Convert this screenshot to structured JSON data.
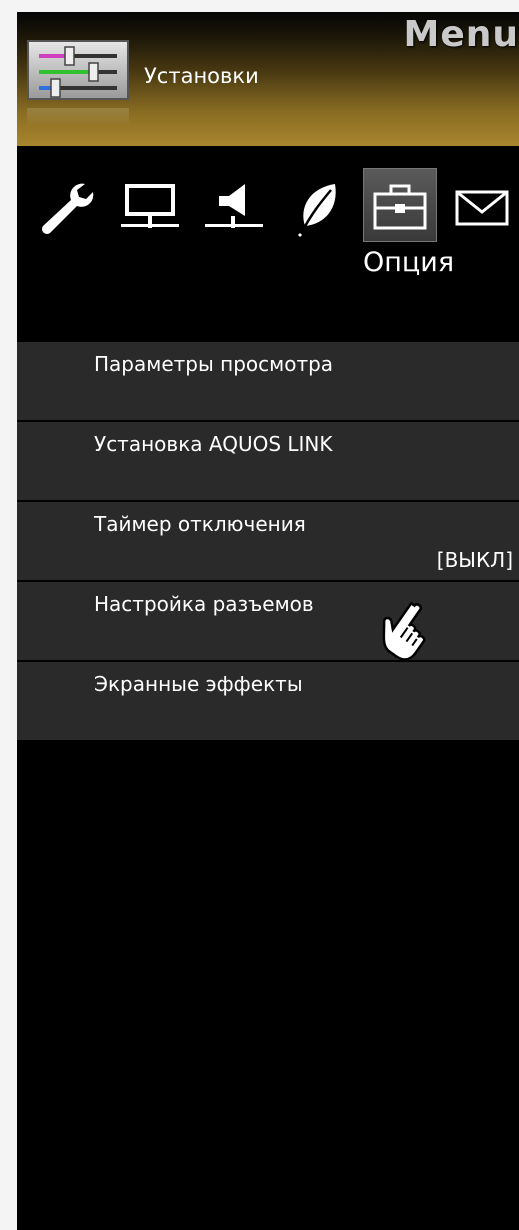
{
  "header": {
    "title": "Menu",
    "subtitle": "Установки"
  },
  "category_icons": [
    {
      "icon": "wrench-icon"
    },
    {
      "icon": "monitor-icon"
    },
    {
      "icon": "speaker-icon"
    },
    {
      "icon": "leaf-icon"
    },
    {
      "icon": "toolbox-icon",
      "selected": true
    },
    {
      "icon": "envelope-icon"
    }
  ],
  "selected_category_label": "Опция",
  "menu": {
    "items": [
      {
        "label": "Параметры просмотра",
        "value": ""
      },
      {
        "label": "Установка AQUOS LINK",
        "value": ""
      },
      {
        "label": "Таймер отключения",
        "value": "[ВЫКЛ]"
      },
      {
        "label": "Настройка разъемов",
        "value": ""
      },
      {
        "label": "Экранные эффекты",
        "value": ""
      }
    ]
  },
  "colors": {
    "header_gold": "#a8862e",
    "item_bg": "#2a2a2a",
    "background": "#000000"
  }
}
